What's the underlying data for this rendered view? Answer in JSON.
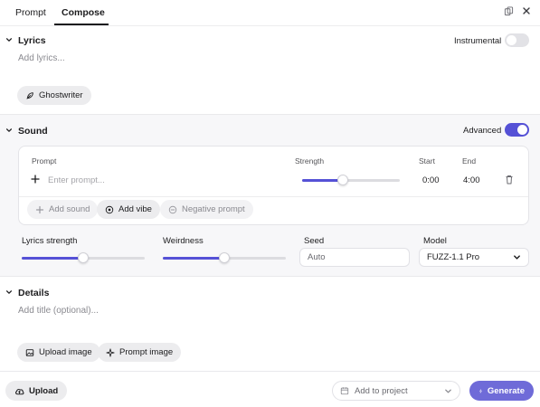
{
  "tabs": [
    {
      "label": "Prompt"
    },
    {
      "label": "Compose"
    }
  ],
  "lyrics": {
    "title": "Lyrics",
    "instrumental_label": "Instrumental",
    "instrumental_on": false,
    "placeholder": "Add lyrics...",
    "ghostwriter_label": "Ghostwriter"
  },
  "sound": {
    "title": "Sound",
    "advanced_label": "Advanced",
    "advanced_on": true,
    "columns": {
      "prompt": "Prompt",
      "strength": "Strength",
      "start": "Start",
      "end": "End"
    },
    "row": {
      "placeholder": "Enter prompt...",
      "strength": 0.42,
      "start": "0:00",
      "end": "4:00"
    },
    "add_sound_label": "Add sound",
    "add_vibe_label": "Add vibe",
    "negative_prompt_label": "Negative prompt",
    "lyrics_strength_label": "Lyrics strength",
    "lyrics_strength": 0.5,
    "weirdness_label": "Weirdness",
    "weirdness": 0.5,
    "seed_label": "Seed",
    "seed_value": "Auto",
    "model_label": "Model",
    "model_value": "FUZZ-1.1 Pro"
  },
  "details": {
    "title": "Details",
    "title_placeholder": "Add title (optional)...",
    "upload_image_label": "Upload image",
    "prompt_image_label": "Prompt image"
  },
  "footer": {
    "upload_label": "Upload",
    "add_to_project_label": "Add to project",
    "generate_label": "Generate"
  },
  "colors": {
    "accent": "#5551d6"
  }
}
